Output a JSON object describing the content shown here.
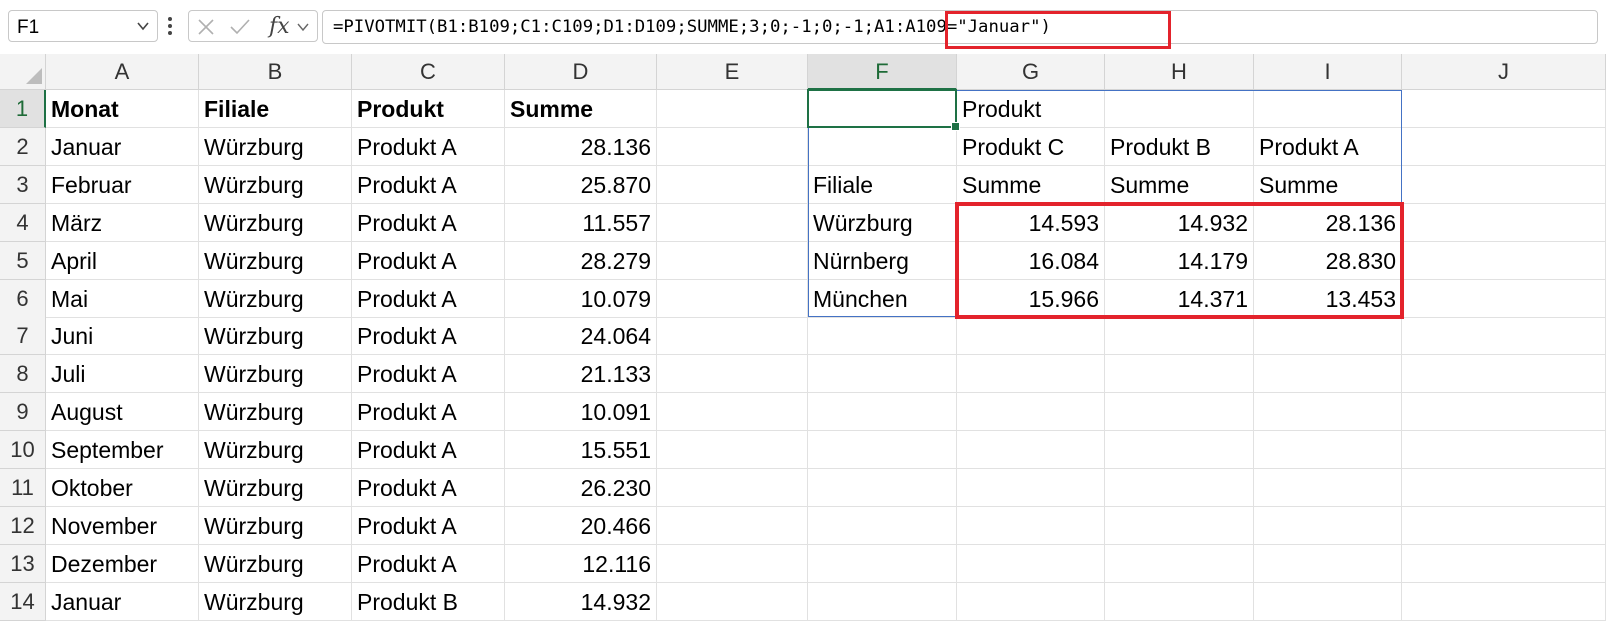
{
  "formula_bar": {
    "name_box": "F1",
    "formula": "=PIVOTMIT(B1:B109;C1:C109;D1:D109;SUMME;3;0;-1;0;-1;A1:A109=\"Januar\")",
    "fx_label": "fx"
  },
  "columns": [
    "A",
    "B",
    "C",
    "D",
    "E",
    "F",
    "G",
    "H",
    "I",
    "J"
  ],
  "rows": [
    "1",
    "2",
    "3",
    "4",
    "5",
    "6",
    "7",
    "8",
    "9",
    "10",
    "11",
    "12",
    "13",
    "14"
  ],
  "source_table": {
    "headers": [
      "Monat",
      "Filiale",
      "Produkt",
      "Summe"
    ],
    "rows": [
      [
        "Januar",
        "Würzburg",
        "Produkt A",
        "28.136"
      ],
      [
        "Februar",
        "Würzburg",
        "Produkt A",
        "25.870"
      ],
      [
        "März",
        "Würzburg",
        "Produkt A",
        "11.557"
      ],
      [
        "April",
        "Würzburg",
        "Produkt A",
        "28.279"
      ],
      [
        "Mai",
        "Würzburg",
        "Produkt A",
        "10.079"
      ],
      [
        "Juni",
        "Würzburg",
        "Produkt A",
        "24.064"
      ],
      [
        "Juli",
        "Würzburg",
        "Produkt A",
        "21.133"
      ],
      [
        "August",
        "Würzburg",
        "Produkt A",
        "10.091"
      ],
      [
        "September",
        "Würzburg",
        "Produkt A",
        "15.551"
      ],
      [
        "Oktober",
        "Würzburg",
        "Produkt A",
        "26.230"
      ],
      [
        "November",
        "Würzburg",
        "Produkt A",
        "20.466"
      ],
      [
        "Dezember",
        "Würzburg",
        "Produkt A",
        "12.116"
      ],
      [
        "Januar",
        "Würzburg",
        "Produkt B",
        "14.932"
      ]
    ]
  },
  "pivot": {
    "col_field": "Produkt",
    "row_field": "Filiale",
    "products": [
      "Produkt C",
      "Produkt B",
      "Produkt A"
    ],
    "measures": [
      "Summe",
      "Summe",
      "Summe"
    ],
    "rows": [
      {
        "label": "Würzburg",
        "values": [
          "14.593",
          "14.932",
          "28.136"
        ]
      },
      {
        "label": "Nürnberg",
        "values": [
          "16.084",
          "14.179",
          "28.830"
        ]
      },
      {
        "label": "München",
        "values": [
          "15.966",
          "14.371",
          "13.453"
        ]
      }
    ]
  },
  "colors": {
    "highlight": "#e3232c",
    "active_cell": "#1e7145",
    "spill_border": "#4472c4"
  }
}
